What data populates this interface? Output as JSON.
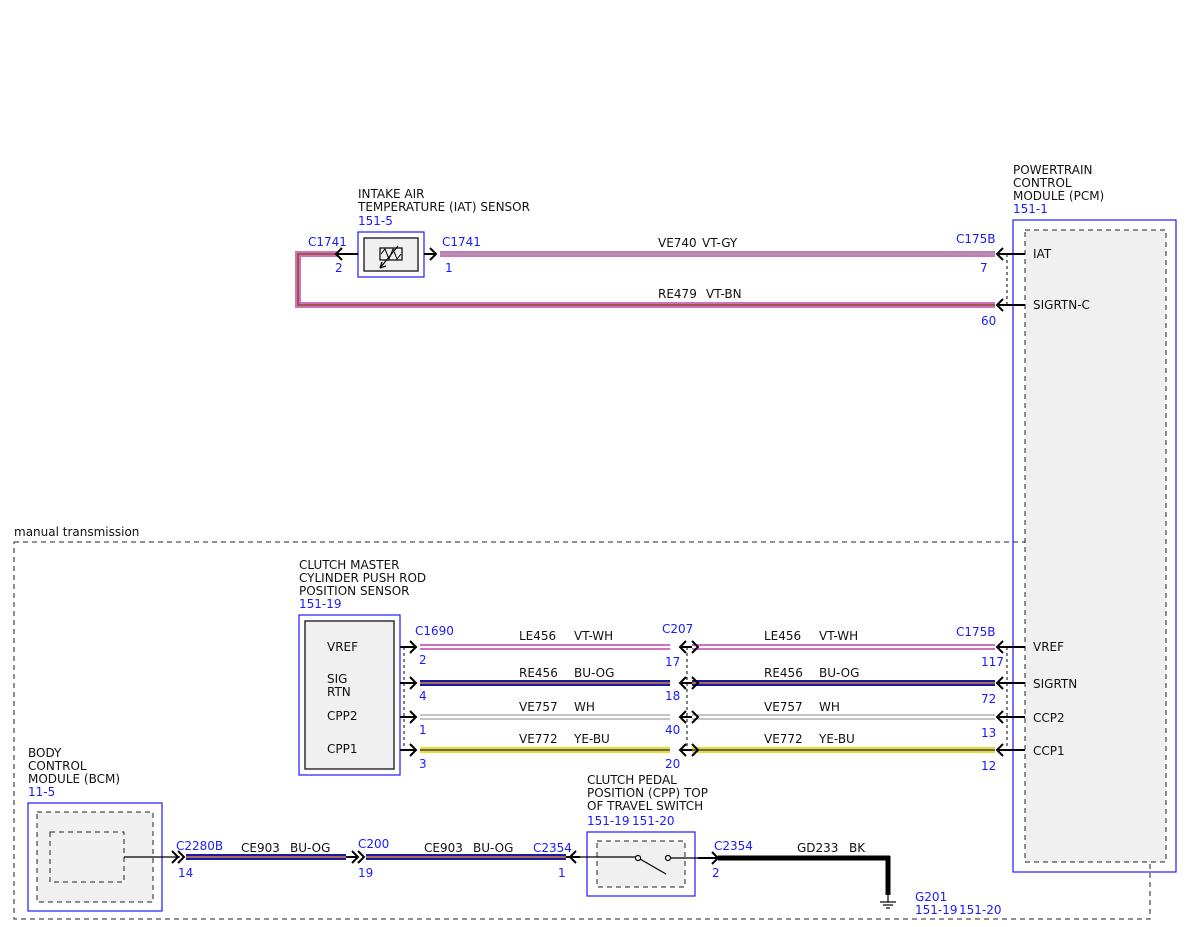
{
  "colors": {
    "label_blue": "#1a1aff",
    "vt": "#d070c0",
    "bu": "#1a1aa0",
    "og": "#ff9a30",
    "gy": "#a0a0a0",
    "bn": "#8a5020",
    "wh": "#ffffff",
    "ye": "#e8e020",
    "bk": "#000000"
  },
  "region": {
    "label": "manual transmission"
  },
  "iat": {
    "title_line1": "INTAKE AIR",
    "title_line2": "TEMPERATURE (IAT) SENSOR",
    "ref": "151-5",
    "conn_left": "C1741",
    "conn_left_pin": "2",
    "conn_right": "C1741",
    "conn_right_pin": "1"
  },
  "pcm": {
    "title_line1": "POWERTRAIN",
    "title_line2": "CONTROL",
    "title_line3": "MODULE (PCM)",
    "ref": "151-1",
    "pins": {
      "iat": "IAT",
      "sigrtn_c": "SIGRTN-C",
      "vref": "VREF",
      "sigrtn": "SIGRTN",
      "ccp2": "CCP2",
      "ccp1": "CCP1"
    }
  },
  "cmc": {
    "title_line1": "CLUTCH MASTER",
    "title_line2": "CYLINDER PUSH ROD",
    "title_line3": "POSITION SENSOR",
    "ref": "151-19",
    "conn": "C1690",
    "pins": {
      "vref": "VREF",
      "sig": "SIG",
      "rtn": "RTN",
      "cpp2": "CPP2",
      "cpp1": "CPP1"
    }
  },
  "bcm": {
    "title_line1": "BODY",
    "title_line2": "CONTROL",
    "title_line3": "MODULE (BCM)",
    "ref": "11-5"
  },
  "cpp_switch": {
    "title_line1": "CLUTCH PEDAL",
    "title_line2": "POSITION (CPP) TOP",
    "title_line3": "OF TRAVEL SWITCH",
    "ref1": "151-19",
    "ref2": "151-20"
  },
  "ground": {
    "name": "G201",
    "ref1": "151-19",
    "ref2": "151-20"
  },
  "wires": {
    "ve740": {
      "circuit": "VE740",
      "color": "VT-GY",
      "conn": "C175B",
      "pin": "7"
    },
    "re479": {
      "circuit": "RE479",
      "color": "VT-BN",
      "pin": "60"
    },
    "le456_left": {
      "circuit": "LE456",
      "color": "VT-WH",
      "pin_src": "2",
      "conn_mid": "C207",
      "pin_mid": "17"
    },
    "le456_right": {
      "circuit": "LE456",
      "color": "VT-WH",
      "conn": "C175B",
      "pin": "117"
    },
    "re456_left": {
      "circuit": "RE456",
      "color": "BU-OG",
      "pin_src": "4",
      "pin_mid": "18"
    },
    "re456_right": {
      "circuit": "RE456",
      "color": "BU-OG",
      "pin": "72"
    },
    "ve757_left": {
      "circuit": "VE757",
      "color": "WH",
      "pin_src": "1",
      "pin_mid": "40"
    },
    "ve757_right": {
      "circuit": "VE757",
      "color": "WH",
      "pin": "13"
    },
    "ve772_left": {
      "circuit": "VE772",
      "color": "YE-BU",
      "pin_src": "3",
      "pin_mid": "20"
    },
    "ve772_right": {
      "circuit": "VE772",
      "color": "YE-BU",
      "pin": "12"
    },
    "ce903_left": {
      "circuit": "CE903",
      "color": "BU-OG",
      "conn": "C2280B",
      "pin": "14"
    },
    "ce903_right": {
      "circuit": "CE903",
      "color": "BU-OG",
      "conn_src": "C200",
      "pin_src": "19",
      "conn": "C2354",
      "pin": "1"
    },
    "gd233": {
      "circuit": "GD233",
      "color": "BK",
      "conn": "C2354",
      "pin": "2"
    }
  }
}
